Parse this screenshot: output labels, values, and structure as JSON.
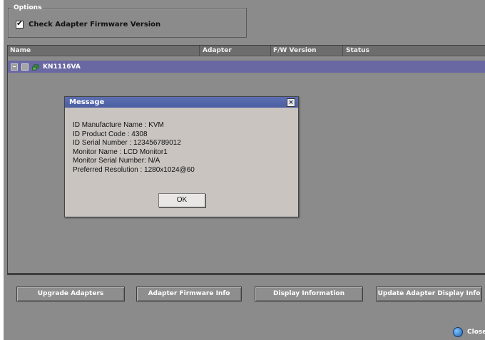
{
  "options": {
    "legend": "Options",
    "check_firmware_label": "Check Adapter Firmware Version",
    "check_firmware_checked": true
  },
  "table": {
    "columns": [
      "Name",
      "Adapter",
      "F/W Version",
      "Status"
    ],
    "rows": [
      {
        "name": "KN1116VA",
        "selected": true
      }
    ]
  },
  "dialog": {
    "title": "Message",
    "close_glyph": "×",
    "lines": [
      "ID Manufacture Name : KVM",
      "ID Product Code : 4308",
      "ID Serial Number : 123456789012",
      "Monitor Name : LCD Monitor1",
      "Monitor Serial Number: N/A",
      "Preferred Resolution : 1280x1024@60"
    ],
    "ok_label": "OK"
  },
  "buttons": {
    "upgrade": "Upgrade Adapters",
    "firmware_info": "Adapter Firmware Info",
    "display_info": "Display Information",
    "update_display": "Update Adapter Display Info"
  },
  "footer": {
    "close_label": "Close"
  },
  "colors": {
    "background": "#8b8b8b",
    "selected_row": "#6a68a3",
    "dialog_title": "#5c6fb3",
    "dialog_body": "#c9c4c0"
  }
}
